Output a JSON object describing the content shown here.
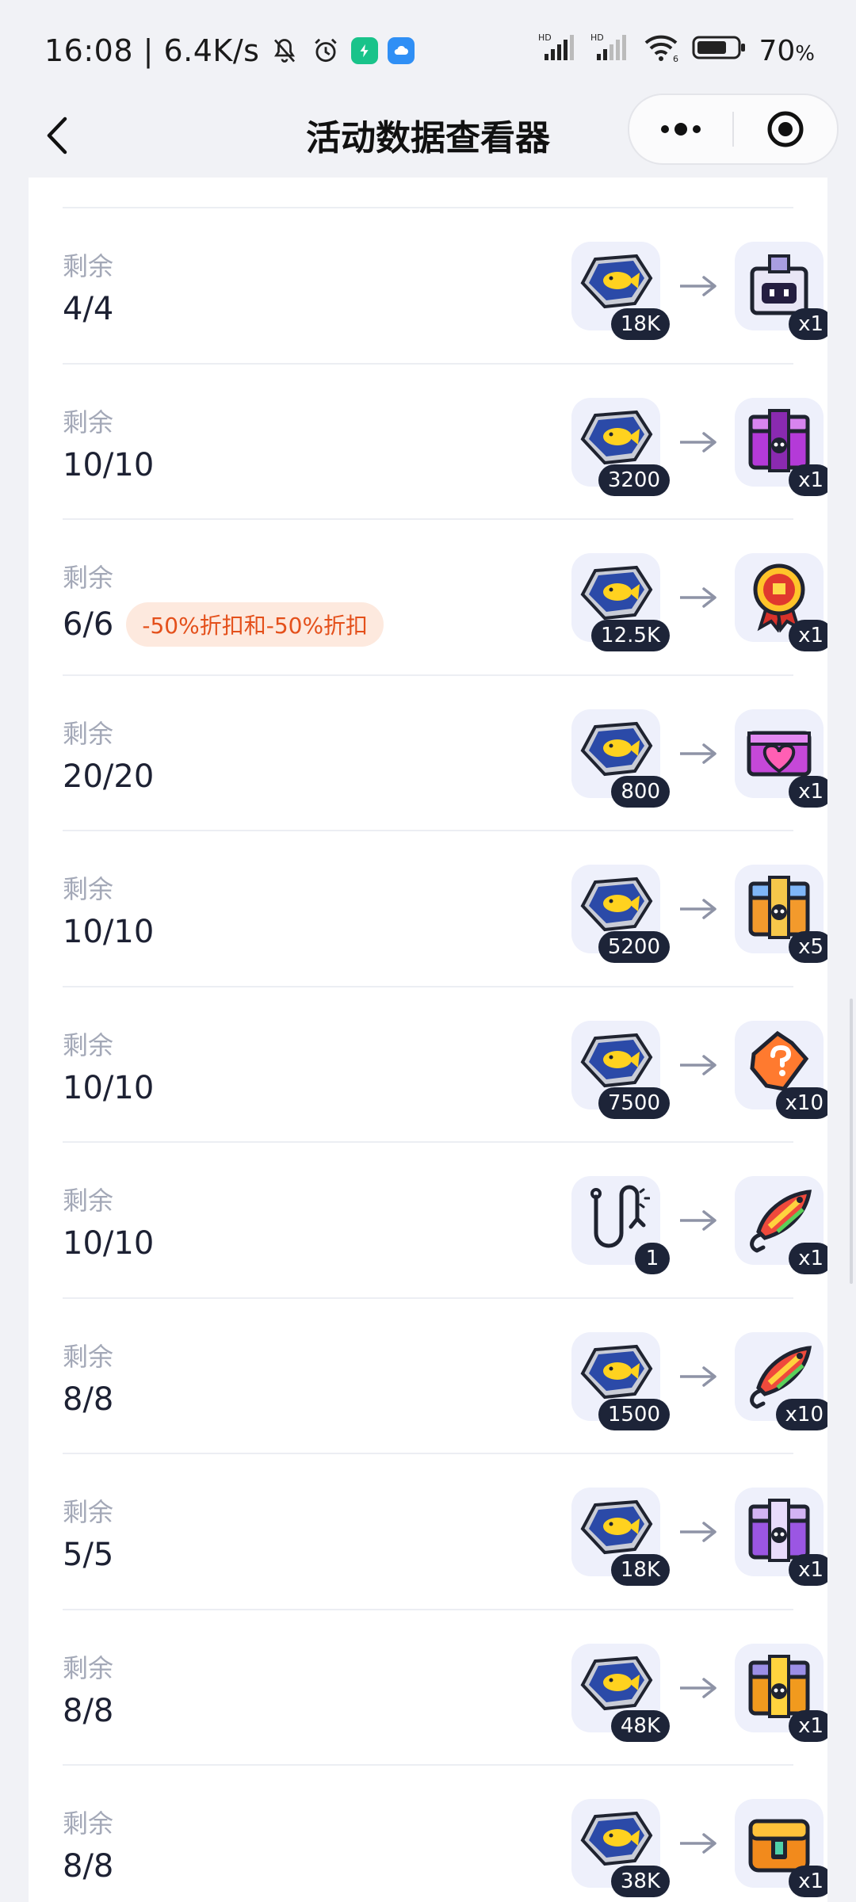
{
  "status_bar": {
    "time_speed": "16:08 | 6.4K/s",
    "battery": "70",
    "battery_unit": "%",
    "icons": [
      "bell-off-icon",
      "alarm-icon",
      "green-app-icon",
      "cloud-app-icon",
      "signal-hd-icon",
      "signal-hd-icon",
      "wifi-icon",
      "battery-icon"
    ]
  },
  "nav": {
    "title": "活动数据查看器",
    "back_icon": "chevron-left-icon",
    "more_icon": "more-dots-icon",
    "close_icon": "target-close-icon"
  },
  "list": {
    "label": "剩余",
    "items": [
      {
        "count": "4/4",
        "tag": "",
        "cost_icon": "fish-coin-icon",
        "cost": "18K",
        "reward_icon": "robot-chest-icon",
        "reward": "x1"
      },
      {
        "count": "10/10",
        "tag": "",
        "cost_icon": "fish-coin-icon",
        "cost": "3200",
        "reward_icon": "purple-box-icon",
        "reward": "x1"
      },
      {
        "count": "6/6",
        "tag": "-50%折扣和-50%折扣",
        "cost_icon": "fish-coin-icon",
        "cost": "12.5K",
        "reward_icon": "medal-icon",
        "reward": "x1"
      },
      {
        "count": "20/20",
        "tag": "",
        "cost_icon": "fish-coin-icon",
        "cost": "800",
        "reward_icon": "heart-gift-icon",
        "reward": "x1"
      },
      {
        "count": "10/10",
        "tag": "",
        "cost_icon": "fish-coin-icon",
        "cost": "5200",
        "reward_icon": "rainbow-box-icon",
        "reward": "x5"
      },
      {
        "count": "10/10",
        "tag": "",
        "cost_icon": "fish-coin-icon",
        "cost": "7500",
        "reward_icon": "mystery-ticket-icon",
        "reward": "x10"
      },
      {
        "count": "10/10",
        "tag": "",
        "cost_icon": "fishing-hook-icon",
        "cost": "1",
        "reward_icon": "lure-icon",
        "reward": "x1"
      },
      {
        "count": "8/8",
        "tag": "",
        "cost_icon": "fish-coin-icon",
        "cost": "1500",
        "reward_icon": "lure-icon",
        "reward": "x10"
      },
      {
        "count": "5/5",
        "tag": "",
        "cost_icon": "fish-coin-icon",
        "cost": "18K",
        "reward_icon": "skull-box-icon",
        "reward": "x1"
      },
      {
        "count": "8/8",
        "tag": "",
        "cost_icon": "fish-coin-icon",
        "cost": "48K",
        "reward_icon": "gold-box-icon",
        "reward": "x1"
      },
      {
        "count": "8/8",
        "tag": "",
        "cost_icon": "fish-coin-icon",
        "cost": "38K",
        "reward_icon": "gold-chest-icon",
        "reward": "x1"
      }
    ]
  },
  "colors": {
    "background": "#f1f2f6",
    "card": "#ffffff",
    "label": "#a3a8b7",
    "tag_bg": "#fde9de",
    "tag_text": "#e4501b",
    "badge_bg": "#1d2438",
    "tile_bg": "#eef0fb"
  }
}
